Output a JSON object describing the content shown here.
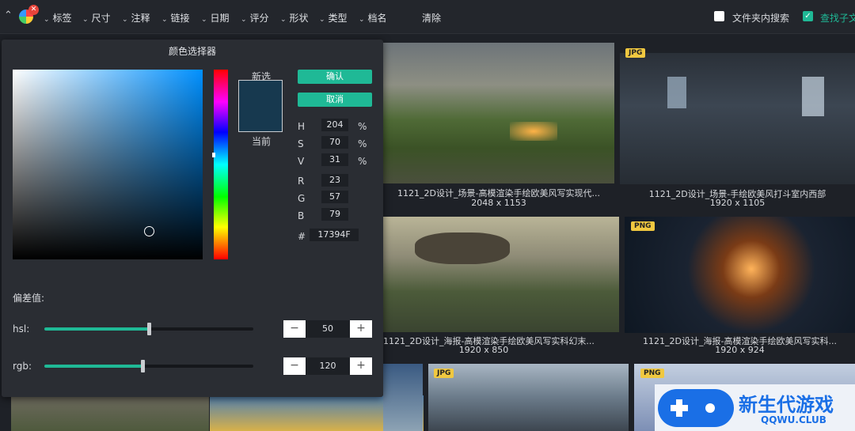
{
  "toolbar": {
    "filters": [
      "标签",
      "尺寸",
      "注释",
      "链接",
      "日期",
      "评分",
      "形状",
      "类型",
      "档名"
    ],
    "clear_label": "清除",
    "search_folder_label": "文件夹内搜索",
    "search_sub_label": "查找子文"
  },
  "gallery": {
    "items": [
      {
        "title": "1121_2D设计_场景-高模渲染手绘欧美风写实现代...",
        "size": "2048 x 1153",
        "badge": ""
      },
      {
        "title": "1121_2D设计_场景-手绘欧美风打斗室内西部",
        "size": "1920 x 1105",
        "badge": "JPG"
      },
      {
        "title": "1121_2D设计_海报-高模渲染手绘欧美风写实科幻末...",
        "size": "1920 x 850",
        "badge": ""
      },
      {
        "title": "1121_2D设计_海报-高模渲染手绘欧美风写实科...",
        "size": "1920 x 924",
        "badge": "PNG"
      },
      {
        "title": "",
        "size": "",
        "badge": ""
      },
      {
        "title": "",
        "size": "",
        "badge": ""
      },
      {
        "title": "",
        "size": "",
        "badge": ""
      },
      {
        "title": "",
        "size": "",
        "badge": "JPG"
      },
      {
        "title": "",
        "size": "",
        "badge": "PNG"
      }
    ]
  },
  "picker": {
    "title": "颜色选择器",
    "new_label": "新选",
    "current_label": "当前",
    "confirm_label": "确认",
    "cancel_label": "取消",
    "hsv": {
      "h": "204",
      "s": "70",
      "v": "31"
    },
    "rgb": {
      "r": "23",
      "g": "57",
      "b": "79"
    },
    "hex": "17394F",
    "percent": "%",
    "labels": {
      "h": "H",
      "s": "S",
      "v": "V",
      "r": "R",
      "g": "G",
      "b": "B",
      "hash": "#"
    },
    "tolerance_label": "偏差值:",
    "hsl_label": "hsl:",
    "rgb_label": "rgb:",
    "hsl_value": "50",
    "rgb_value": "120",
    "hsl_level": 0.5,
    "rgb_level": 0.47,
    "minus": "−",
    "plus": "+"
  },
  "watermark": {
    "brand": "新生代游戏",
    "domain": "QQWU.CLUB"
  },
  "colors": {
    "accent": "#1fb996",
    "swatch": "#17394f",
    "badge": "#f0c840"
  }
}
